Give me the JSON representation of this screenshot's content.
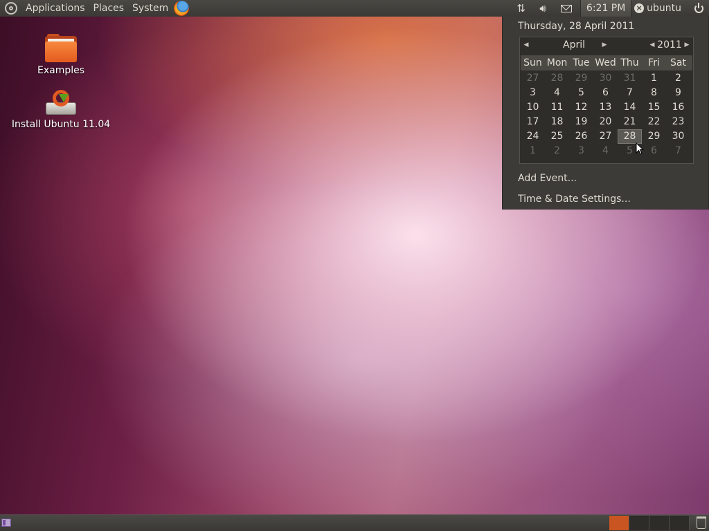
{
  "top_panel": {
    "menus": [
      "Applications",
      "Places",
      "System"
    ],
    "clock": "6:21 PM",
    "user": "ubuntu"
  },
  "desktop": {
    "icons": [
      {
        "label": "Examples",
        "icon": "folder-icon"
      },
      {
        "label": "Install Ubuntu 11.04",
        "icon": "installer-icon"
      }
    ]
  },
  "calendar_menu": {
    "date_header": "Thursday, 28 April 2011",
    "month": "April",
    "year": "2011",
    "weekdays": [
      "Sun",
      "Mon",
      "Tue",
      "Wed",
      "Thu",
      "Fri",
      "Sat"
    ],
    "weeks": [
      [
        "27",
        "28",
        "29",
        "30",
        "31",
        "1",
        "2"
      ],
      [
        "3",
        "4",
        "5",
        "6",
        "7",
        "8",
        "9"
      ],
      [
        "10",
        "11",
        "12",
        "13",
        "14",
        "15",
        "16"
      ],
      [
        "17",
        "18",
        "19",
        "20",
        "21",
        "22",
        "23"
      ],
      [
        "24",
        "25",
        "26",
        "27",
        "28",
        "29",
        "30"
      ],
      [
        "1",
        "2",
        "3",
        "4",
        "5",
        "6",
        "7"
      ]
    ],
    "selected_day": "28",
    "add_event": "Add Event...",
    "time_date_settings": "Time & Date Settings..."
  },
  "colors": {
    "panel": "#3c3b37",
    "accent": "#c95522",
    "text": "#dfdbd2"
  }
}
